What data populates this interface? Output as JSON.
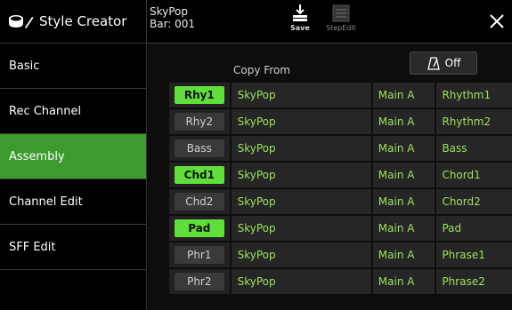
{
  "header": {
    "title": "Style Creator",
    "style_name": "SkyPop",
    "bar": "Bar: 001",
    "save_label": "Save",
    "stepedit_label": "StepEdit",
    "close_icon": "close-icon"
  },
  "sidebar": {
    "items": [
      {
        "label": "Basic",
        "active": false
      },
      {
        "label": "Rec Channel",
        "active": false
      },
      {
        "label": "Assembly",
        "active": true
      },
      {
        "label": "Channel Edit",
        "active": false
      },
      {
        "label": "SFF Edit",
        "active": false
      }
    ]
  },
  "main": {
    "copy_from_label": "Copy From",
    "metronome_label": "Off",
    "rows": [
      {
        "channel": "Rhy1",
        "on": true,
        "style": "SkyPop",
        "section": "Main A",
        "part": "Rhythm1"
      },
      {
        "channel": "Rhy2",
        "on": false,
        "style": "SkyPop",
        "section": "Main A",
        "part": "Rhythm2"
      },
      {
        "channel": "Bass",
        "on": false,
        "style": "SkyPop",
        "section": "Main A",
        "part": "Bass"
      },
      {
        "channel": "Chd1",
        "on": true,
        "style": "SkyPop",
        "section": "Main A",
        "part": "Chord1"
      },
      {
        "channel": "Chd2",
        "on": false,
        "style": "SkyPop",
        "section": "Main A",
        "part": "Chord2"
      },
      {
        "channel": "Pad",
        "on": true,
        "style": "SkyPop",
        "section": "Main A",
        "part": "Pad"
      },
      {
        "channel": "Phr1",
        "on": false,
        "style": "SkyPop",
        "section": "Main A",
        "part": "Phrase1"
      },
      {
        "channel": "Phr2",
        "on": false,
        "style": "SkyPop",
        "section": "Main A",
        "part": "Phrase2"
      }
    ]
  },
  "colors": {
    "accent_green": "#3c9a2e",
    "channel_on": "#5fdf3a",
    "value_text": "#9de05f"
  }
}
